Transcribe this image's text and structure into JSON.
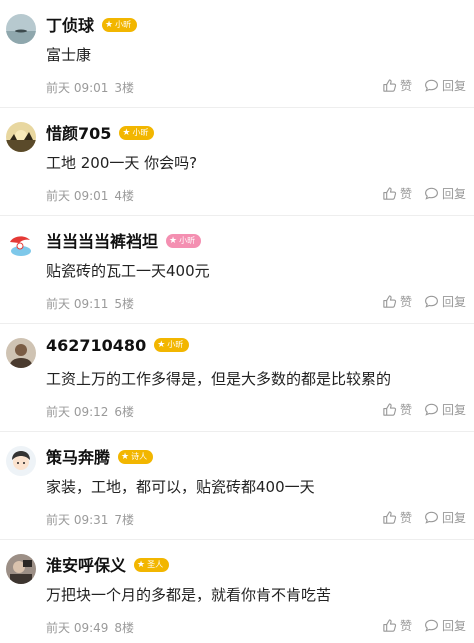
{
  "comments": [
    {
      "user": "丁侦球",
      "badge": "小昕",
      "badge_color": "#f2b600",
      "text": "富士康",
      "time": "前天 09:01",
      "floor": "3楼",
      "avatar": "lake"
    },
    {
      "user": "惜颜705",
      "badge": "小昕",
      "badge_color": "#f2b600",
      "text": "工地 200一天 你会吗?",
      "time": "前天 09:01",
      "floor": "4楼",
      "avatar": "sunset"
    },
    {
      "user": "当当当当裤裆坦",
      "badge": "小昕",
      "badge_color": "#f48fb1",
      "text": "贴瓷砖的瓦工一天400元",
      "time": "前天 09:11",
      "floor": "5楼",
      "avatar": "cartoon"
    },
    {
      "user": "462710480",
      "badge": "小昕",
      "badge_color": "#f2b600",
      "text": "工资上万的工作多得是，但是大多数的都是比较累的",
      "time": "前天 09:12",
      "floor": "6楼",
      "avatar": "portrait"
    },
    {
      "user": "策马奔腾",
      "badge": "诗人",
      "badge_color": "#f2b600",
      "text": "家装，工地，都可以，贴瓷砖都400一天",
      "time": "前天 09:31",
      "floor": "7楼",
      "avatar": "boy"
    },
    {
      "user": "淮安呼保义",
      "badge": "圣人",
      "badge_color": "#f2b600",
      "text": "万把块一个月的多都是，就看你肯不肯吃苦",
      "time": "前天 09:49",
      "floor": "8楼",
      "avatar": "photo"
    }
  ],
  "actions": {
    "like_label": "赞",
    "reply_label": "回复"
  },
  "colors": {
    "meta": "#9a9a9a",
    "divider": "#eeeeee",
    "badge_gold": "#f2b600",
    "badge_pink": "#f48fb1"
  },
  "icons": {
    "like": "thumbs-up-icon",
    "reply": "speech-bubble-icon",
    "badge": "star-icon"
  }
}
